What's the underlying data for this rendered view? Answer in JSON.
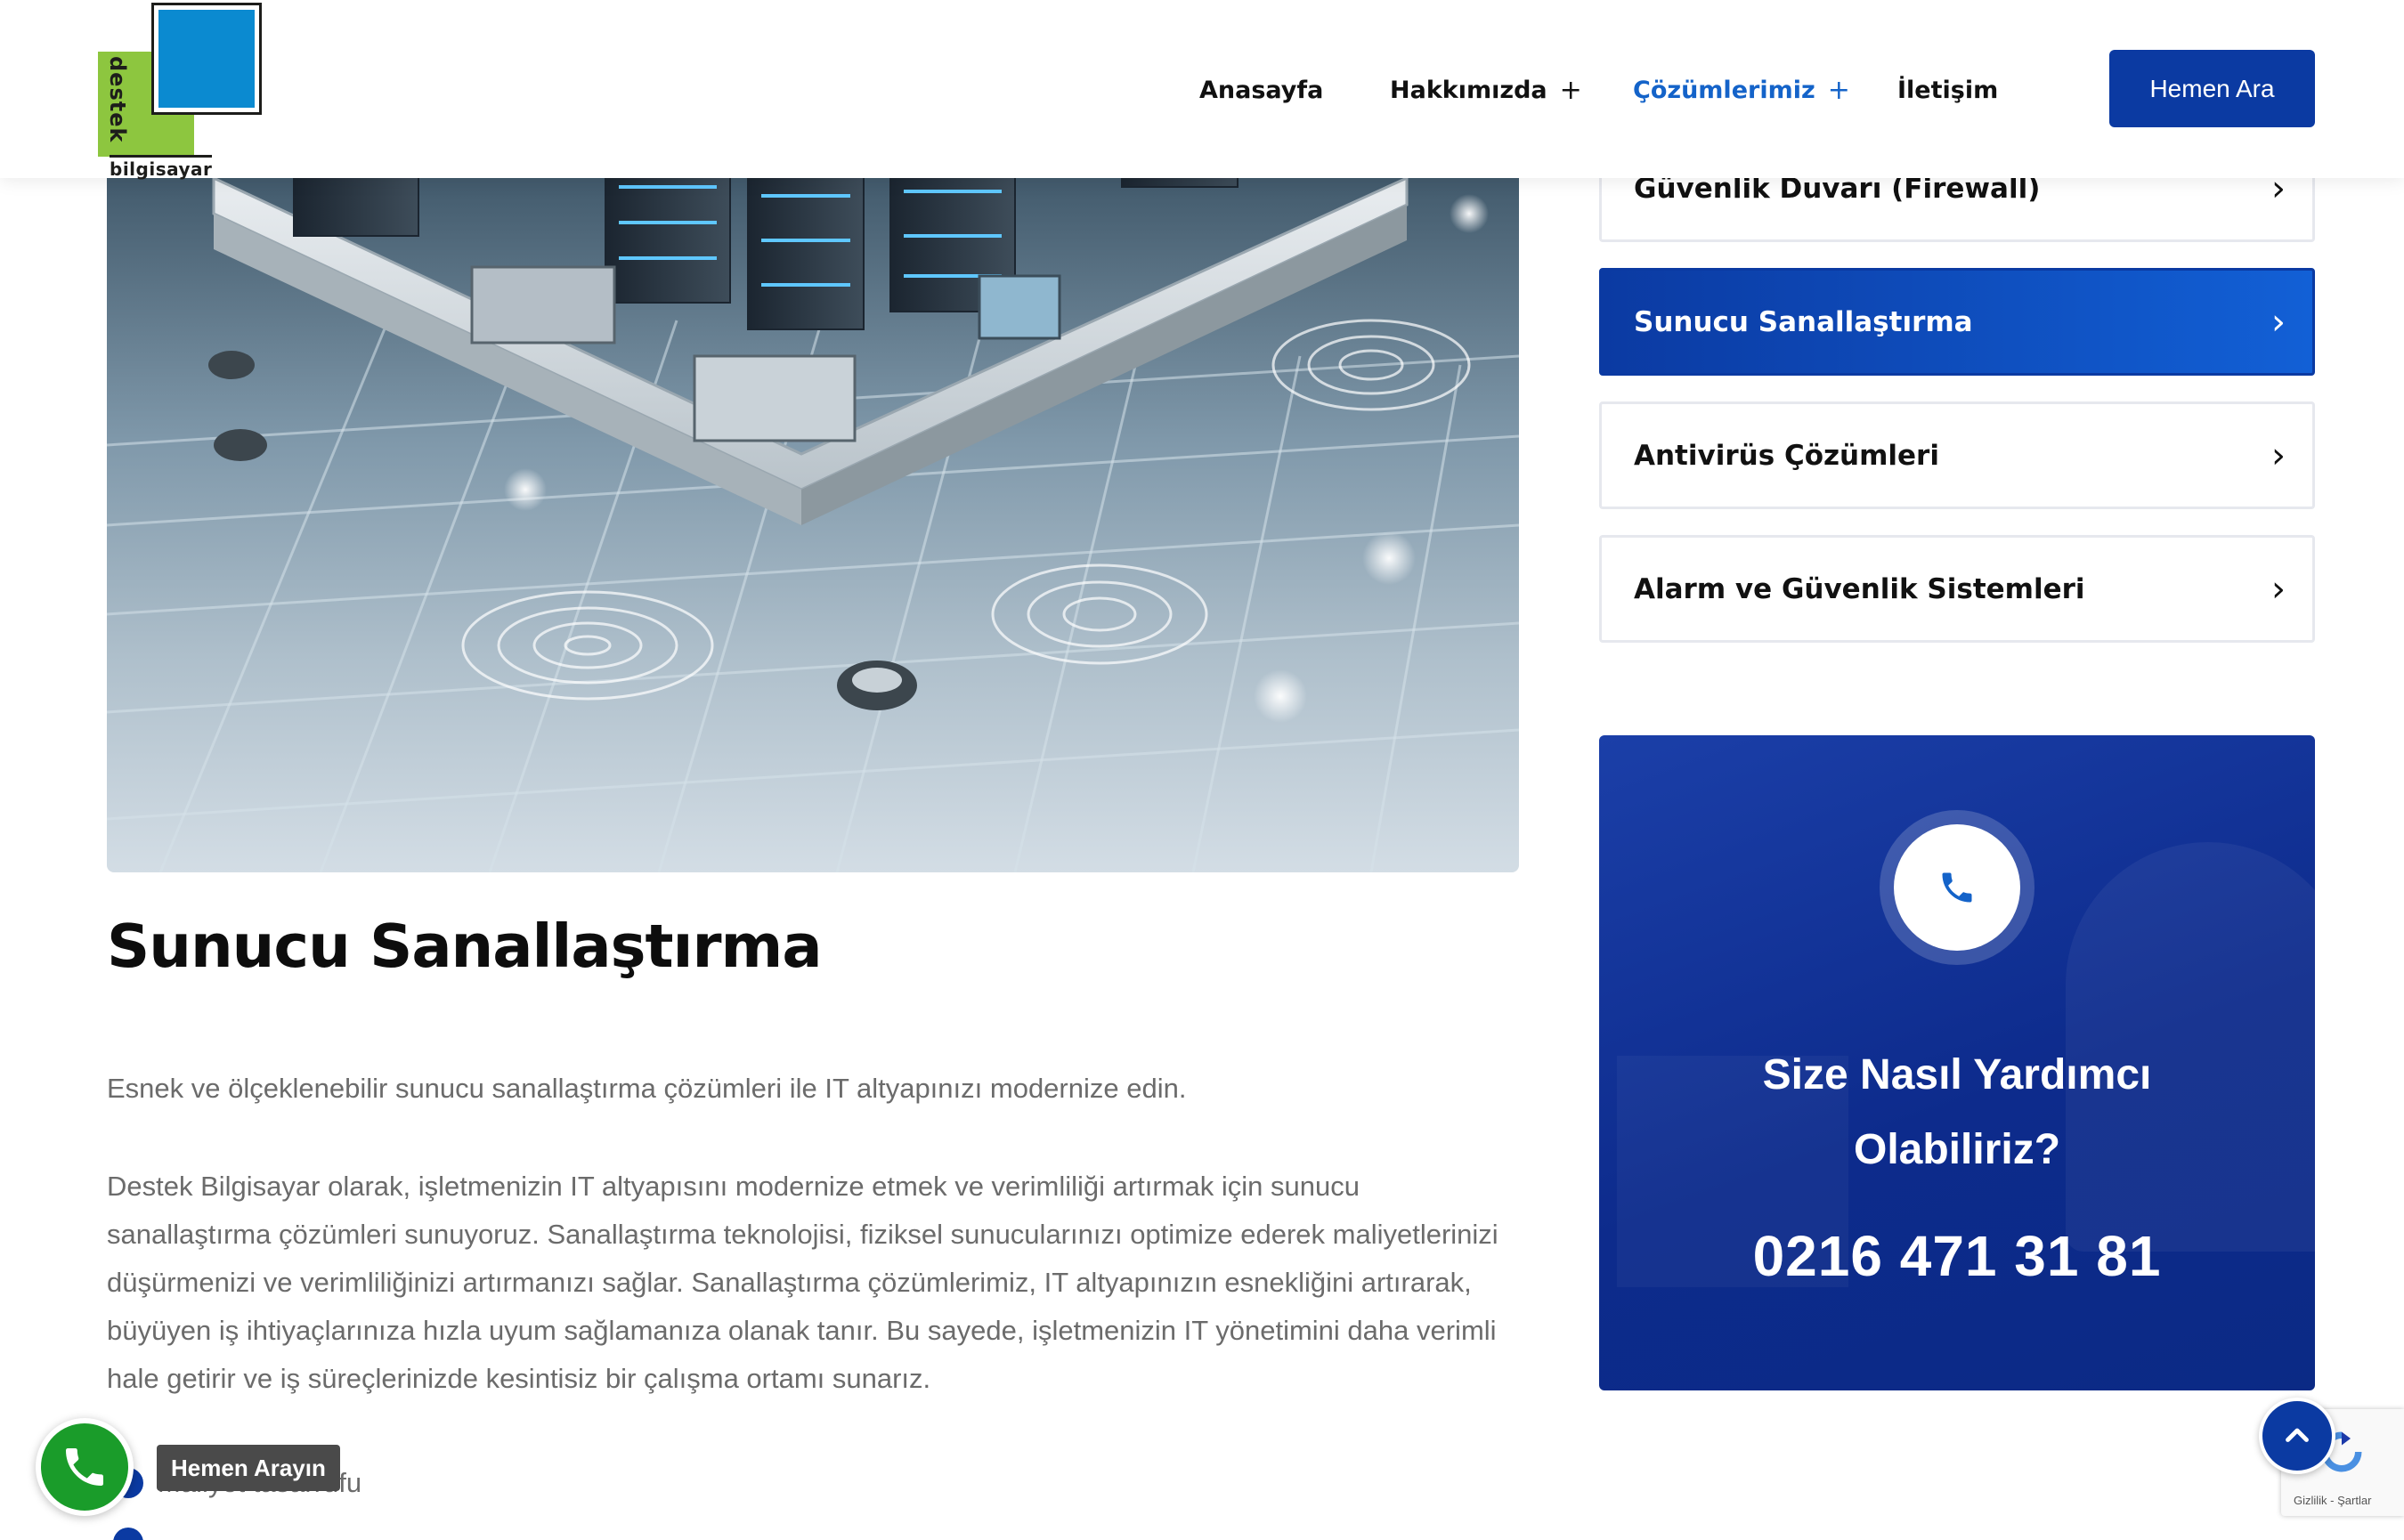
{
  "header": {
    "logo_text_vertical": "destek",
    "logo_text_bottom": "bilgisayar",
    "nav": [
      {
        "label": "Anasayfa",
        "has_submenu": false
      },
      {
        "label": "Hakkımızda",
        "has_submenu": true
      },
      {
        "label": "Çözümlerimiz",
        "has_submenu": true,
        "active": true
      },
      {
        "label": "İletişim",
        "has_submenu": false
      }
    ],
    "submenu_symbol": "+",
    "cta_label": "Hemen Ara"
  },
  "main": {
    "title": "Sunucu Sanallaştırma",
    "lead": "Esnek ve ölçeklenebilir sunucu sanallaştırma çözümleri ile IT altyapınızı modernize edin.",
    "body": "Destek Bilgisayar olarak, işletmenizin IT altyapısını modernize etmek ve verimliliği artırmak için sunucu sanallaştırma çözümleri sunuyoruz. Sanallaştırma teknolojisi, fiziksel sunucularınızı optimize ederek maliyetlerinizi düşürmenizi ve verimliliğinizi artırmanızı sağlar. Sanallaştırma çözümlerimiz, IT altyapınızın esnekliğini artırarak, büyüyen iş ihtiyaçlarınıza hızla uyum sağlamanıza olanak tanır. Bu sayede, işletmenizin IT yönetimini daha verimli hale getirir ve iş süreçlerinizde kesintisiz bir çalışma ortamı sunarız.",
    "bullets": [
      "Maliyet tasarrufu"
    ]
  },
  "sidebar": {
    "items": [
      {
        "label": "Güvenlik Duvarı (Firewall)",
        "active": false
      },
      {
        "label": "Sunucu Sanallaştırma",
        "active": true
      },
      {
        "label": "Antivirüs Çözümleri",
        "active": false
      },
      {
        "label": "Alarm ve Güvenlik Sistemleri",
        "active": false
      }
    ],
    "chevron": "›"
  },
  "help_card": {
    "title_line1": "Size Nasıl Yardımcı",
    "title_line2": "Olabiliriz?",
    "phone": "0216 471 31 81",
    "icon": "phone-icon"
  },
  "floating": {
    "call_tooltip": "Hemen Arayın",
    "call_icon": "phone-icon",
    "scroll_top_icon": "chevron-up-icon",
    "recaptcha_text": "Gizlilik - Şartlar"
  },
  "colors": {
    "brand_blue": "#0b3aa2",
    "accent_blue": "#1463c9",
    "logo_green": "#8dc63f",
    "logo_blue": "#0b8ad0",
    "whatsapp_green": "#1a9c2a",
    "body_text": "#6b6b6b"
  }
}
